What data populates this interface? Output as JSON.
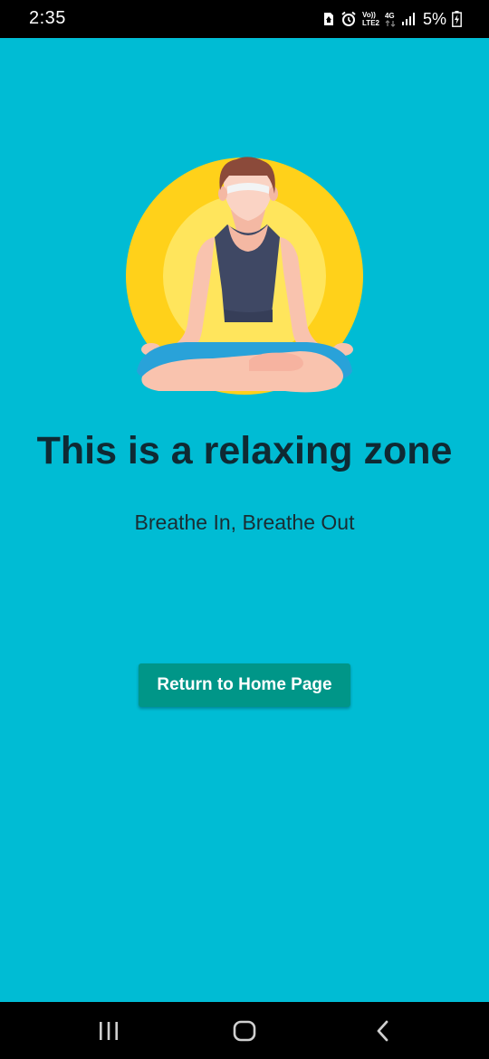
{
  "status_bar": {
    "time": "2:35",
    "network_top": "Vo))",
    "network_bottom": "LTE2",
    "network_type": "4G",
    "battery": "5%",
    "icons": [
      "sim-icon",
      "alarm-icon",
      "volte-icon",
      "signal-icon",
      "battery-icon"
    ]
  },
  "main": {
    "illustration": "meditation-illustration",
    "headline": "This is a relaxing zone",
    "subtitle": "Breathe In, Breathe Out",
    "button_label": "Return to Home Page"
  },
  "navigation": {
    "icons": [
      "recent-apps-icon",
      "home-icon",
      "back-icon"
    ]
  },
  "colors": {
    "background": "#00BCD4",
    "button": "#009688",
    "sun_outer": "#FFD11A",
    "sun_inner": "#FFE55C"
  }
}
